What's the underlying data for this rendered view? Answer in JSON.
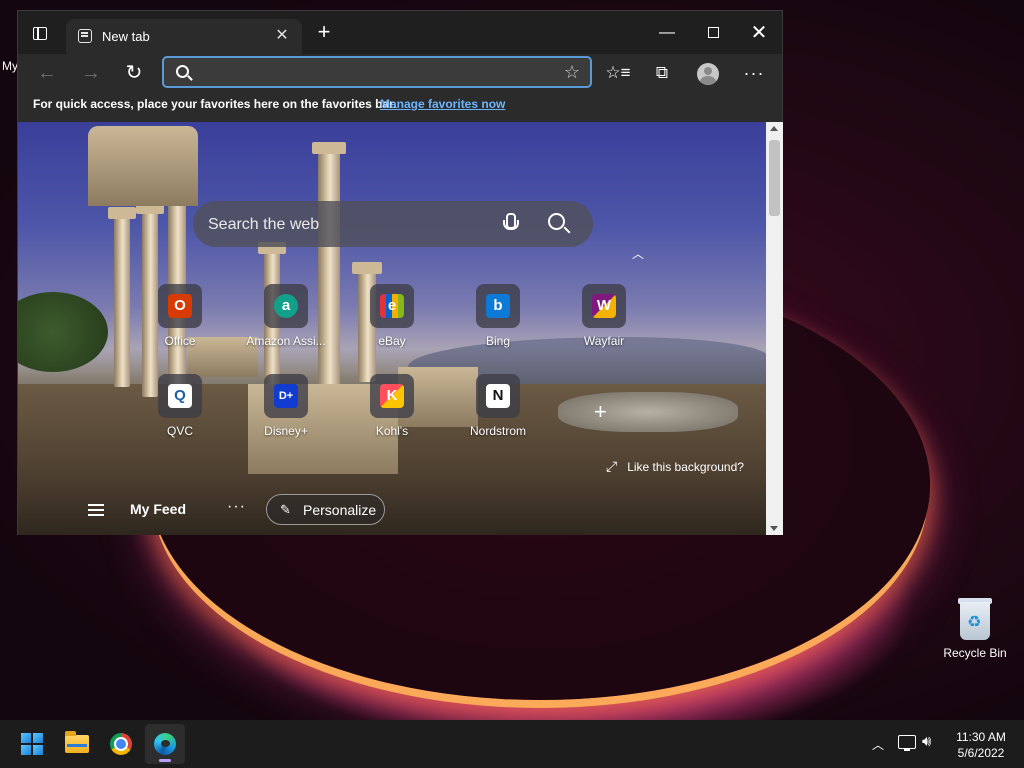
{
  "desktop": {
    "partial_label": "My",
    "recycle_bin_label": "Recycle Bin"
  },
  "browser": {
    "tab_title": "New tab",
    "address_placeholder": "",
    "address_value": "",
    "favbar_message": "For quick access, place your favorites here on the favorites bar.",
    "favbar_link": "Manage favorites now"
  },
  "newtab": {
    "search_placeholder": "Search the web",
    "quick_links": [
      {
        "label": "Office",
        "icon": "office-icon",
        "color": "#d83b01",
        "glyph": "O"
      },
      {
        "label": "Amazon Assi...",
        "icon": "amazon-assistant-icon",
        "color": "#12a08a",
        "glyph": "a"
      },
      {
        "label": "eBay",
        "icon": "ebay-icon",
        "color": "#e53238",
        "glyph": "e"
      },
      {
        "label": "Bing",
        "icon": "bing-icon",
        "color": "#0c7ad6",
        "glyph": "b"
      },
      {
        "label": "Wayfair",
        "icon": "wayfair-icon",
        "color": "#7f187f",
        "glyph": "W"
      },
      {
        "label": "QVC",
        "icon": "qvc-icon",
        "color": "#1f5fa3",
        "glyph": "Q"
      },
      {
        "label": "Disney+",
        "icon": "disney-plus-icon",
        "color": "#113ccf",
        "glyph": "D+"
      },
      {
        "label": "Kohl's",
        "icon": "kohls-icon",
        "color": "#ff4f5a",
        "glyph": "K"
      },
      {
        "label": "Nordstrom",
        "icon": "nordstrom-icon",
        "color": "#ffffff",
        "glyph": "N"
      }
    ],
    "like_background": "Like this background?",
    "feed_label": "My Feed",
    "personalize_label": "Personalize"
  },
  "taskbar": {
    "time": "11:30 AM",
    "date": "5/6/2022"
  }
}
